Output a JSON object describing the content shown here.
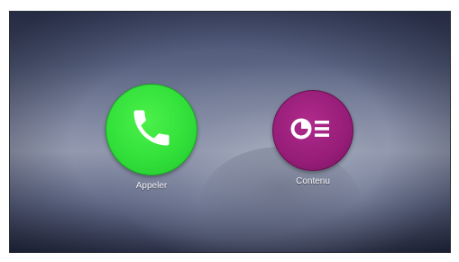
{
  "apps": [
    {
      "label": "Appeler",
      "icon": "phone-icon",
      "color": "#33e23a"
    },
    {
      "label": "Contenu",
      "icon": "content-list-icon",
      "color": "#961d78"
    }
  ]
}
